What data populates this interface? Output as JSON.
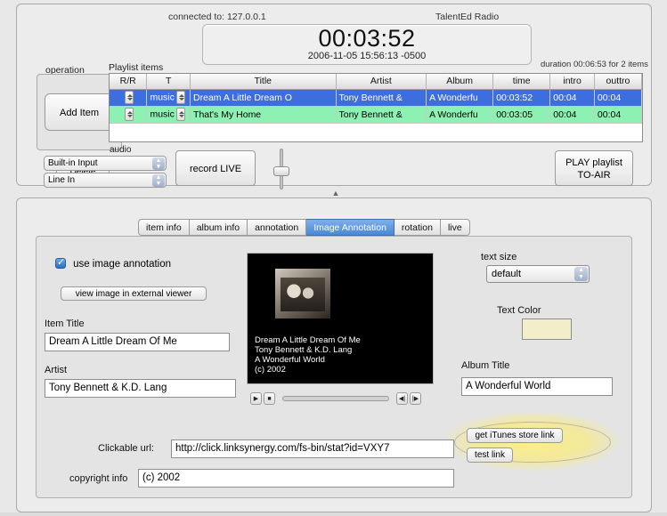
{
  "top": {
    "connected_to": "connected to: 127.0.0.1",
    "station": "TalentEd Radio",
    "clock_time": "00:03:52",
    "clock_date": "2006-11-05 15:56:13 -0500",
    "duration": "duration 00:06:53 for 2 items",
    "operation_label": "operation",
    "add_item": "Add Item",
    "delete": "Delete",
    "audio_label": "audio",
    "audio_input": "Built-in Input",
    "audio_source": "Line In",
    "record_live": "record LIVE",
    "play_toair_line1": "PLAY playlist",
    "play_toair_line2": "TO-AIR"
  },
  "playlist": {
    "label": "Playlist items",
    "columns": [
      "R/R",
      "T",
      "Title",
      "Artist",
      "Album",
      "time",
      "intro",
      "outtro"
    ],
    "rows": [
      {
        "rr": "",
        "type": "music",
        "title": "Dream A Little Dream O",
        "artist": "Tony Bennett &",
        "album": "A Wonderfu",
        "time": "00:03:52",
        "intro": "00:04",
        "outtro": "00:04",
        "state": "selected"
      },
      {
        "rr": "",
        "type": "music",
        "title": "That's My Home",
        "artist": "Tony Bennett &",
        "album": "A Wonderfu",
        "time": "00:03:05",
        "intro": "00:04",
        "outtro": "00:04",
        "state": "green"
      }
    ]
  },
  "tabs": [
    {
      "label": "item info",
      "active": false
    },
    {
      "label": "album info",
      "active": false
    },
    {
      "label": "annotation",
      "active": false
    },
    {
      "label": "Image Annotation",
      "active": true
    },
    {
      "label": "rotation",
      "active": false
    },
    {
      "label": "live",
      "active": false
    }
  ],
  "annotation": {
    "use_image_annotation": "use image annotation",
    "view_image_external": "view image in external viewer",
    "item_title_label": "Item Title",
    "item_title_value": "Dream A Little Dream Of Me",
    "artist_label": "Artist",
    "artist_value": "Tony Bennett & K.D. Lang",
    "text_size_label": "text size",
    "text_size_value": "default",
    "text_color_label": "Text Color",
    "text_color_hex": "#f2eec9",
    "album_title_label": "Album Title",
    "album_title_value": "A Wonderful World",
    "clickable_url_label": "Clickable url:",
    "clickable_url_value": "http://click.linksynergy.com/fs-bin/stat?id=VXY7",
    "copyright_label": "copyright info",
    "copyright_value": "(c)  2002",
    "itunes_button": "get iTunes store link",
    "test_link_button": "test link"
  },
  "preview": {
    "line1": "Dream A Little Dream Of Me",
    "line2": "Tony Bennett & K.D. Lang",
    "line3": "A Wonderful World",
    "line4": "(c)  2002"
  },
  "colors": {
    "selection_blue": "#3c6ee0",
    "row_green": "#8ef1b4",
    "tab_active": "#4a88d8"
  }
}
